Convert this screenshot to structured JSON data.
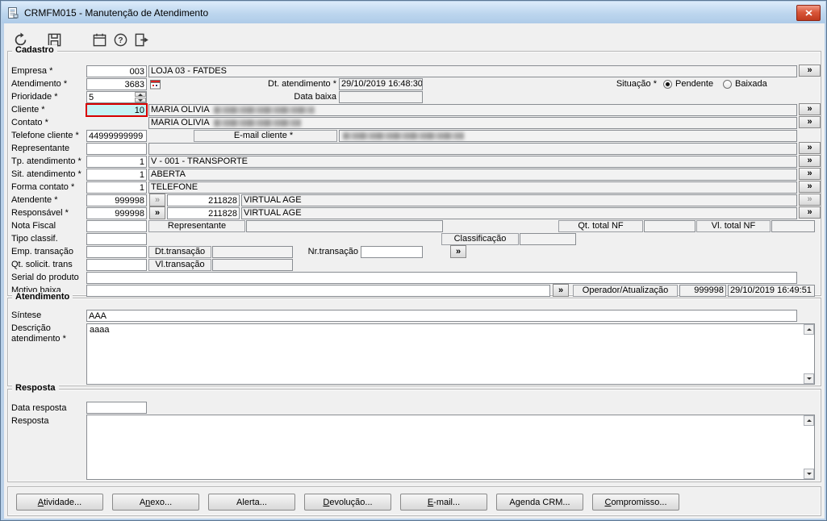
{
  "window": {
    "title": "CRMFM015 - Manutenção de Atendimento"
  },
  "controls": {
    "lookup_glyph": "»"
  },
  "colors": {
    "titlebar": "#bdd6ee",
    "client_bg": "#f0f0f0",
    "highlight_field_bg": "#c6f3f5",
    "highlight_field_border": "#d80000",
    "close_button": "#c8412a"
  },
  "toolbar": {
    "icons": [
      "refresh",
      "save",
      "calendar",
      "help",
      "exit"
    ]
  },
  "cadastro": {
    "title": "Cadastro",
    "empresa": {
      "label": "Empresa *",
      "code": "003",
      "desc": "LOJA 03 - FATDES"
    },
    "atendimento": {
      "label": "Atendimento *",
      "value": "3683"
    },
    "dt_atendimento": {
      "label": "Dt. atendimento *",
      "value": "29/10/2019 16:48:30"
    },
    "situacao": {
      "label": "Situação *",
      "pendente": "Pendente",
      "baixada": "Baixada",
      "selected": "Pendente"
    },
    "prioridade": {
      "label": "Prioridade *",
      "value": "5"
    },
    "data_baixa": {
      "label": "Data baixa",
      "value": ""
    },
    "cliente": {
      "label": "Cliente *",
      "code": "10",
      "desc": "MARIA OLIVIA"
    },
    "contato": {
      "label": "Contato *",
      "desc": "MARIA OLIVIA"
    },
    "telefone_cliente": {
      "label": "Telefone cliente *",
      "value": "44999999999"
    },
    "email_cliente": {
      "label": "E-mail cliente *",
      "value": ""
    },
    "representante": {
      "label": "Representante",
      "code": "",
      "desc": ""
    },
    "tp_atendimento": {
      "label": "Tp. atendimento *",
      "code": "1",
      "desc": "V - 001 - TRANSPORTE"
    },
    "sit_atendimento": {
      "label": "Sit. atendimento *",
      "code": "1",
      "desc": "ABERTA"
    },
    "forma_contato": {
      "label": "Forma contato *",
      "code": "1",
      "desc": "TELEFONE"
    },
    "atendente": {
      "label": "Atendente *",
      "code": "999998",
      "matricula": "211828",
      "desc": "VIRTUAL AGE"
    },
    "responsavel": {
      "label": "Responsável *",
      "code": "999998",
      "matricula": "211828",
      "desc": "VIRTUAL AGE"
    },
    "nota_fiscal": {
      "label": "Nota Fiscal",
      "value": "",
      "representante_header": "Representante",
      "representante_value": "",
      "qt_total_label": "Qt. total NF",
      "qt_total_value": "",
      "vl_total_label": "Vl. total NF",
      "vl_total_value": ""
    },
    "tipo_classif": {
      "label": "Tipo classif.",
      "value": "",
      "classificacao_label": "Classificação",
      "classificacao_value": ""
    },
    "emp_transacao": {
      "label": "Emp. transação",
      "value": "",
      "dt_label": "Dt.transação",
      "dt_value": "",
      "nr_label": "Nr.transação",
      "nr_value": ""
    },
    "qt_solicit_trans": {
      "label": "Qt. solicit. trans",
      "value": "",
      "vl_label": "Vl.transação",
      "vl_value": ""
    },
    "serial_produto": {
      "label": "Serial do produto",
      "value": ""
    },
    "motivo_baixa": {
      "label": "Motivo baixa",
      "value": ""
    },
    "operador": {
      "label": "Operador/Atualização",
      "code": "999998",
      "datetime": "29/10/2019 16:49:51"
    }
  },
  "atendimento_grp": {
    "title": "Atendimento",
    "sintese": {
      "label": "Síntese",
      "value": "AAA"
    },
    "descricao": {
      "label": "Descrição atendimento *",
      "value": "aaaa"
    }
  },
  "resposta_grp": {
    "title": "Resposta",
    "data_resposta": {
      "label": "Data resposta",
      "value": ""
    },
    "resposta": {
      "label": "Resposta",
      "value": ""
    }
  },
  "footer": {
    "buttons": [
      {
        "pre": "",
        "u": "A",
        "post": "tividade..."
      },
      {
        "pre": "A",
        "u": "n",
        "post": "exo..."
      },
      {
        "pre": "Alerta...",
        "u": "",
        "post": ""
      },
      {
        "pre": "",
        "u": "D",
        "post": "evolução..."
      },
      {
        "pre": "",
        "u": "E",
        "post": "-mail..."
      },
      {
        "pre": "Agenda CRM...",
        "u": "",
        "post": ""
      },
      {
        "pre": "",
        "u": "C",
        "post": "ompromisso..."
      }
    ]
  }
}
